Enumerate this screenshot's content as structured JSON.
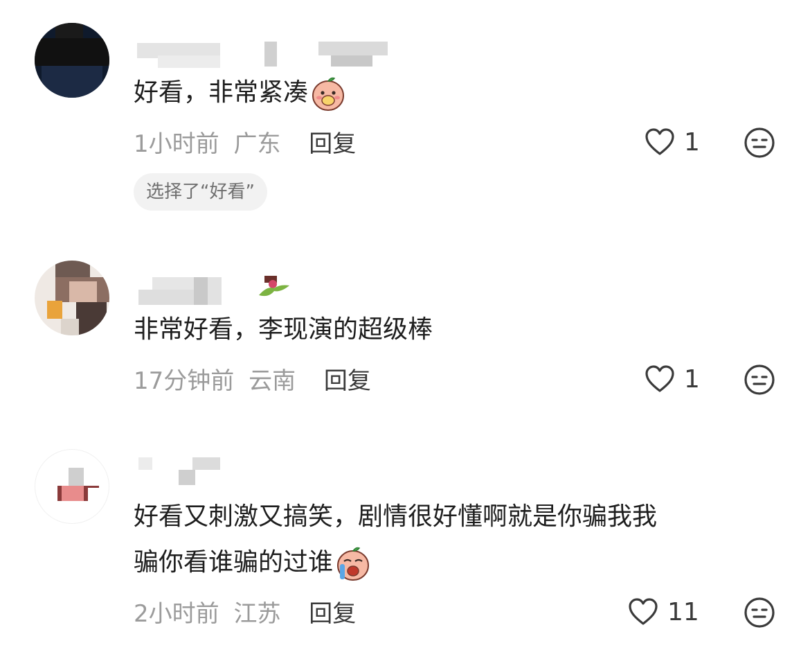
{
  "comments": [
    {
      "text": "好看，非常紧凑",
      "time": "1小时前",
      "region": "广东",
      "reply_label": "回复",
      "like_count": "1",
      "chip": "选择了“好看”",
      "emoji": "shy-peach-emoji"
    },
    {
      "text": "非常好看，李现演的超级棒",
      "time": "17分钟前",
      "region": "云南",
      "reply_label": "回复",
      "like_count": "1",
      "badge": "flower-badge-icon"
    },
    {
      "text_line1": "好看又刺激又搞笑，剧情很好懂啊就是你骗我我",
      "text_line2": "骗你看谁骗的过谁",
      "time": "2小时前",
      "region": "江苏",
      "reply_label": "回复",
      "like_count": "11",
      "emoji": "crying-peach-emoji"
    }
  ],
  "colors": {
    "text": "#1e1e1e",
    "meta": "#9b9b9b",
    "chip_bg": "#f2f2f2",
    "icon": "#3a3a3a"
  }
}
